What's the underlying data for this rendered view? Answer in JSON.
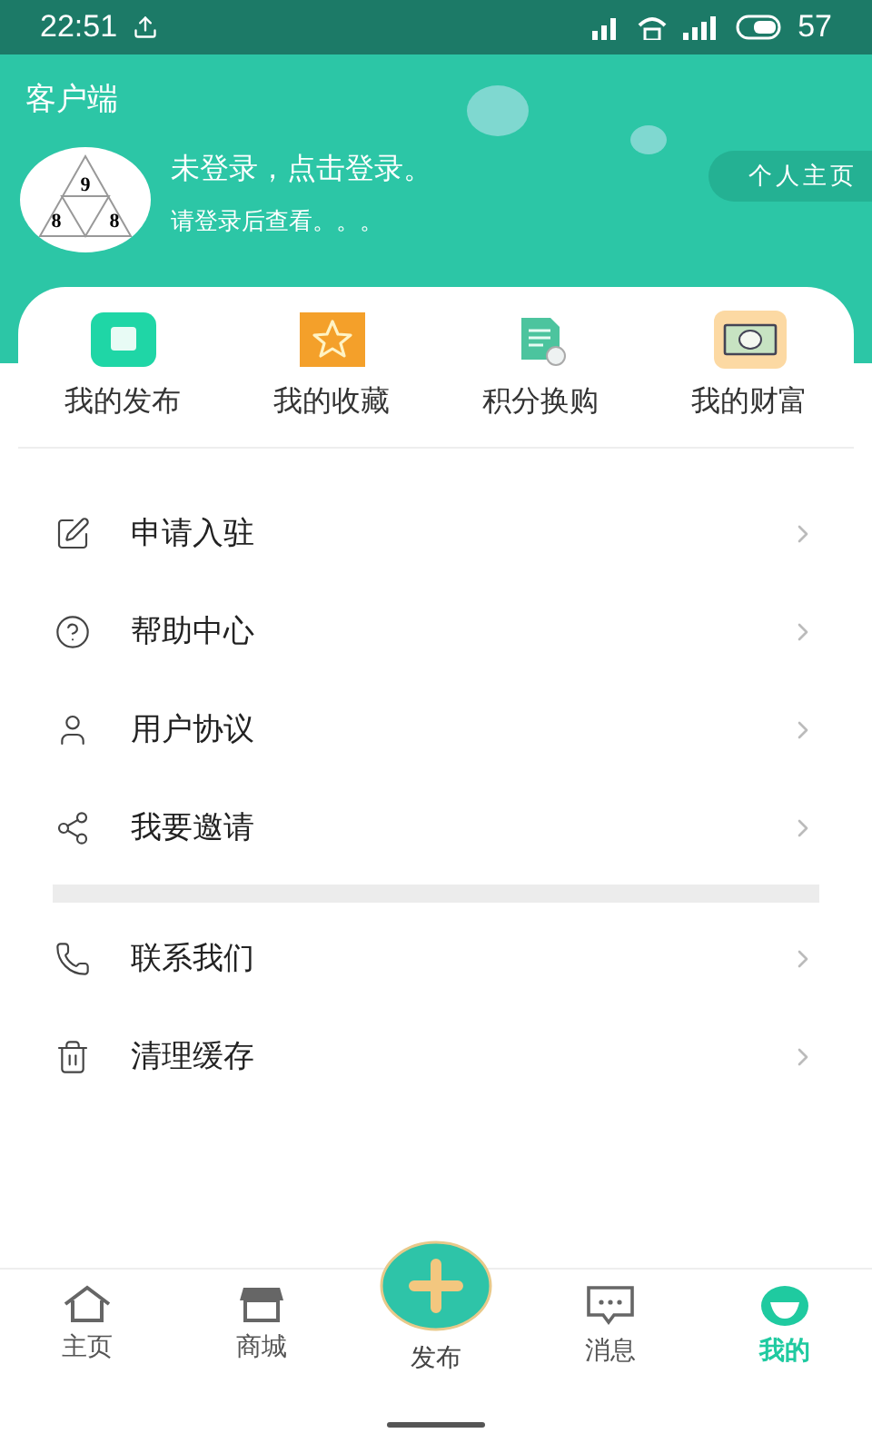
{
  "status_bar": {
    "time": "22:51",
    "battery": "57"
  },
  "header": {
    "title": "客户端",
    "avatar_digits": [
      "9",
      "8",
      "8"
    ],
    "login_title": "未登录，点击登录。",
    "login_hint": "请登录后查看。。。",
    "profile_button": "个人主页"
  },
  "shortcuts": [
    {
      "label": "我的发布"
    },
    {
      "label": "我的收藏"
    },
    {
      "label": "积分换购"
    },
    {
      "label": "我的财富"
    }
  ],
  "menu_groups": [
    [
      {
        "label": "申请入驻"
      },
      {
        "label": "帮助中心"
      },
      {
        "label": "用户协议"
      },
      {
        "label": "我要邀请"
      }
    ],
    [
      {
        "label": "联系我们"
      },
      {
        "label": "清理缓存"
      }
    ]
  ],
  "bottom_nav": [
    {
      "label": "主页",
      "kind": "tab",
      "selected": false
    },
    {
      "label": "商城",
      "kind": "tab",
      "selected": false
    },
    {
      "label": "发布",
      "kind": "publish",
      "selected": false
    },
    {
      "label": "消息",
      "kind": "tab",
      "selected": false
    },
    {
      "label": "我的",
      "kind": "tab",
      "selected": true
    }
  ]
}
